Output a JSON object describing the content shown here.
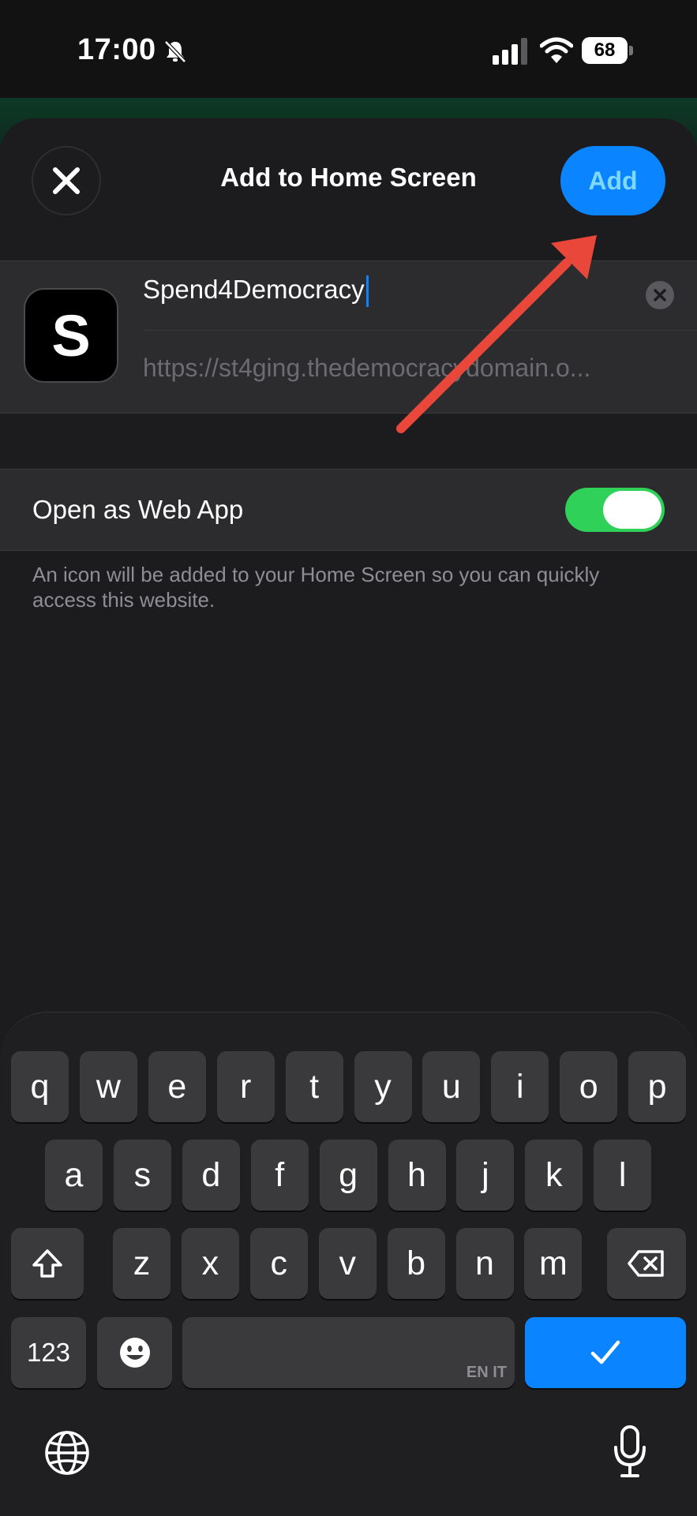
{
  "status": {
    "time": "17:00",
    "battery": "68"
  },
  "sheet": {
    "title": "Add to Home Screen",
    "add_label": "Add"
  },
  "app": {
    "icon_letter": "S",
    "name": "Spend4Democracy",
    "url": "https://st4ging.thedemocracydomain.o..."
  },
  "settings": {
    "open_as_web_app_label": "Open as Web App",
    "open_as_web_app": true,
    "hint": "An icon will be added to your Home Screen so you can quickly access this website."
  },
  "keyboard": {
    "row1": [
      "q",
      "w",
      "e",
      "r",
      "t",
      "y",
      "u",
      "i",
      "o",
      "p"
    ],
    "row2": [
      "a",
      "s",
      "d",
      "f",
      "g",
      "h",
      "j",
      "k",
      "l"
    ],
    "row3": [
      "z",
      "x",
      "c",
      "v",
      "b",
      "n",
      "m"
    ],
    "numbers_label": "123",
    "space_lang": "EN IT"
  },
  "colors": {
    "accent": "#0a84ff",
    "toggle_on": "#30d158",
    "arrow": "#e8473a"
  }
}
